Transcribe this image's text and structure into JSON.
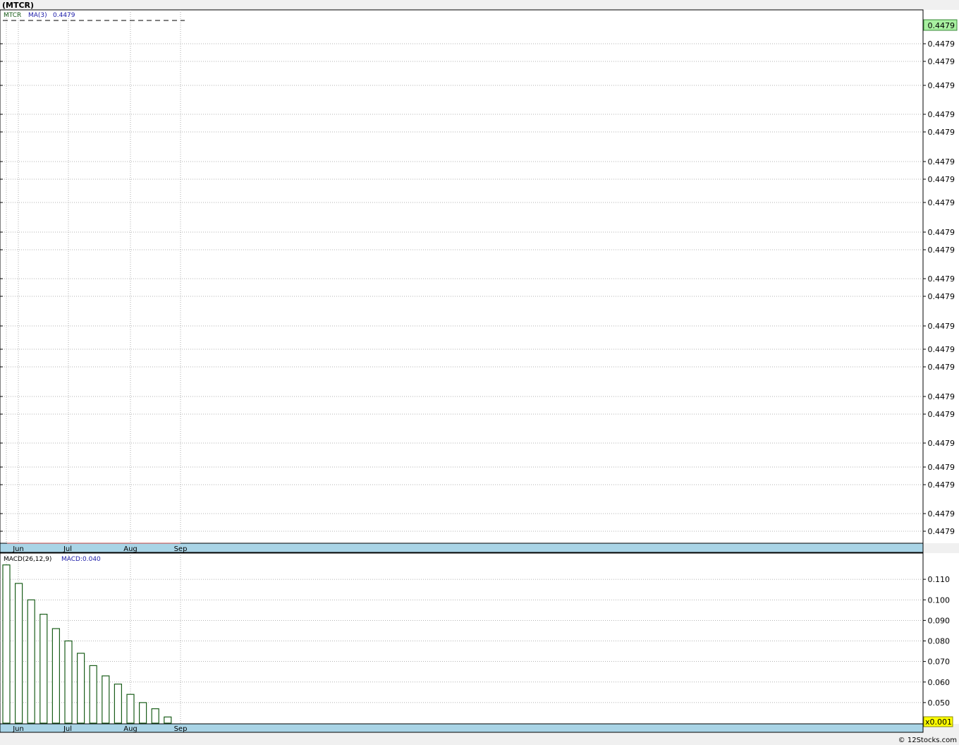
{
  "title": "(MTCR)",
  "footer": "© 12Stocks.com",
  "price_panel": {
    "legend": {
      "symbol": "MTCR",
      "ma_label": "MA(3)",
      "ma_value": "0.4479"
    },
    "current_price": "0.4479",
    "y_tick_labels": [
      "0.4479",
      "0.4479",
      "0.4479",
      "0.4479",
      "0.4479",
      "0.4479",
      "0.4479",
      "0.4479",
      "0.4479",
      "0.4479",
      "0.4479",
      "0.4479",
      "0.4479",
      "0.4479",
      "0.4479",
      "0.4479",
      "0.4479",
      "0.4479",
      "0.4479",
      "0.4479",
      "0.4479",
      "0.4479",
      "0.4479",
      "0.4479"
    ],
    "x_tick_labels": [
      "Jun",
      "Jul",
      "Aug",
      "Sep"
    ]
  },
  "macd_panel": {
    "legend": {
      "label": "MACD(26,12,9)",
      "value_label": "MACD:0.040"
    },
    "multiplier": "x0.001",
    "x_tick_labels": [
      "Jun",
      "Jul",
      "Aug",
      "Sep"
    ]
  },
  "colors": {
    "price_line": "#000000",
    "macd_bar": "#1a5e1a",
    "axis_band": "#a9d4e6",
    "current_price_bg": "#a8f0a0",
    "multiplier_bg": "#ffff00",
    "legend_symbol": "#1a5e1a",
    "legend_ma": "#1a1aa8"
  },
  "chart_data": [
    {
      "type": "line",
      "title": "(MTCR)",
      "x": [
        "Jun",
        "Jul",
        "Aug",
        "Sep"
      ],
      "series": [
        {
          "name": "MA(3)",
          "values": [
            0.4479,
            0.4479,
            0.4479,
            0.4479
          ]
        }
      ],
      "grid": true
    },
    {
      "type": "bar",
      "title": "MACD(26,12,9)",
      "x_ticks": [
        "Jun",
        "Jul",
        "Aug",
        "Sep"
      ],
      "values": [
        0.117,
        0.108,
        0.1,
        0.093,
        0.086,
        0.08,
        0.074,
        0.068,
        0.063,
        0.059,
        0.054,
        0.05,
        0.047,
        0.043
      ],
      "ylim": [
        0.04,
        0.12
      ],
      "yticks": [
        0.11,
        0.1,
        0.09,
        0.08,
        0.07,
        0.06,
        0.05
      ],
      "grid": true
    }
  ]
}
